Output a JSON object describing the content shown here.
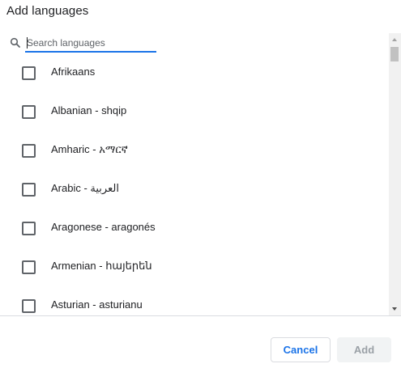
{
  "dialog": {
    "title": "Add languages"
  },
  "search": {
    "placeholder": "Search languages",
    "value": ""
  },
  "languages": [
    {
      "label": "Afrikaans",
      "checked": false
    },
    {
      "label": "Albanian - shqip",
      "checked": false
    },
    {
      "label": "Amharic - አማርኛ",
      "checked": false
    },
    {
      "label": "Arabic - العربية",
      "checked": false
    },
    {
      "label": "Aragonese - aragonés",
      "checked": false
    },
    {
      "label": "Armenian - հայերեն",
      "checked": false
    },
    {
      "label": "Asturian - asturianu",
      "checked": false
    }
  ],
  "buttons": {
    "cancel_label": "Cancel",
    "add_label": "Add",
    "add_enabled": false
  },
  "colors": {
    "accent": "#1a73e8",
    "text": "#202124",
    "disabled_text": "#9aa0a6",
    "disabled_bg": "#f1f3f4",
    "divider": "#dadce0"
  },
  "icons": {
    "search": "search-icon",
    "checkbox": "checkbox-unchecked-icon",
    "scroll_up": "chevron-up-icon",
    "scroll_down": "chevron-down-icon"
  }
}
